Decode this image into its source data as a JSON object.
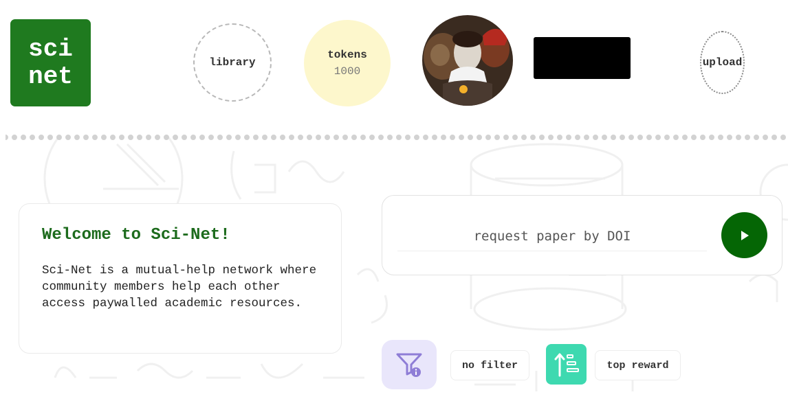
{
  "logo": {
    "line1": "sci",
    "line2": "net"
  },
  "nav": {
    "library_label": "library",
    "tokens_label": "tokens",
    "tokens_count": "1000",
    "upload_label": "upload"
  },
  "welcome": {
    "title": "Welcome to Sci-Net!",
    "body": "Sci-Net is a mutual-help network where community members help each other access paywalled academic resources."
  },
  "request": {
    "placeholder": "request paper by DOI",
    "submit_icon": "play-icon"
  },
  "controls": {
    "filter_icon": "filter-info-icon",
    "filter_label": "no filter",
    "sort_icon": "sort-ascending-icon",
    "sort_label": "top reward"
  },
  "colors": {
    "brand_green": "#1f7a1f",
    "token_yellow": "#fdf7cc",
    "filter_lavender": "#e9e6fb",
    "sort_teal": "#3ed9b0"
  }
}
